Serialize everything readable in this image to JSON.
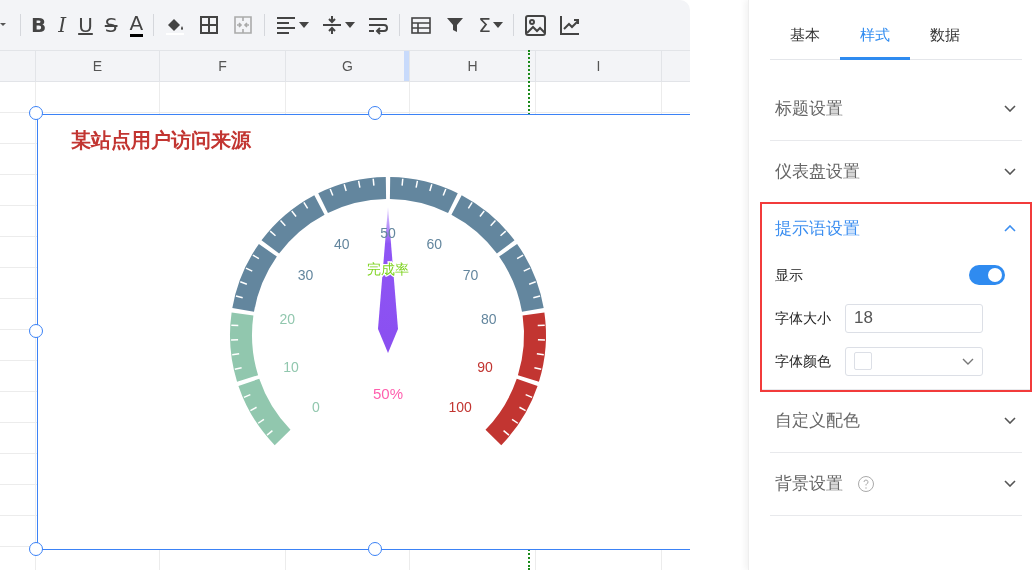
{
  "toolbar": [
    {
      "kind": "bold",
      "label": "B",
      "disabled": false,
      "dropdown": false
    },
    {
      "kind": "italic",
      "label": "I",
      "disabled": false,
      "dropdown": false
    },
    {
      "kind": "underline",
      "label": "U",
      "disabled": false,
      "dropdown": false
    },
    {
      "kind": "strike",
      "label": "S",
      "disabled": false,
      "dropdown": false
    },
    {
      "kind": "color",
      "label": "A",
      "disabled": false,
      "dropdown": false
    },
    {
      "kind": "fill",
      "disabled": false,
      "dropdown": false
    },
    {
      "kind": "borders",
      "disabled": false,
      "dropdown": false
    },
    {
      "kind": "merge",
      "disabled": true,
      "dropdown": false
    },
    {
      "kind": "align",
      "disabled": false,
      "dropdown": true
    },
    {
      "kind": "valign",
      "disabled": false,
      "dropdown": true
    },
    {
      "kind": "wrap",
      "disabled": false,
      "dropdown": false
    },
    {
      "kind": "table",
      "disabled": false,
      "dropdown": false
    },
    {
      "kind": "filter",
      "disabled": false,
      "dropdown": false
    },
    {
      "kind": "sum",
      "label": "Σ",
      "disabled": false,
      "dropdown": true
    },
    {
      "kind": "image",
      "disabled": false,
      "dropdown": false
    },
    {
      "kind": "chart",
      "disabled": false,
      "dropdown": false
    }
  ],
  "columns": [
    {
      "label": "E",
      "selected": false
    },
    {
      "label": "F",
      "selected": false
    },
    {
      "label": "G",
      "selected": true
    },
    {
      "label": "H",
      "selected": false
    },
    {
      "label": "I",
      "selected": false
    }
  ],
  "chart": {
    "title": "某站点用户访问来源",
    "gauge": {
      "name": "完成率",
      "detail": "50%",
      "level": 0.5,
      "segments": [
        {
          "color": "#91c7ae"
        },
        {
          "color": "#91c7ae"
        },
        {
          "color": "#63869e"
        },
        {
          "color": "#63869e"
        },
        {
          "color": "#63869e"
        },
        {
          "color": "#63869e"
        },
        {
          "color": "#63869e"
        },
        {
          "color": "#63869e"
        },
        {
          "color": "#c23531"
        },
        {
          "color": "#c23531"
        }
      ],
      "tick_labels": [
        "0",
        "10",
        "20",
        "30",
        "40",
        "50",
        "60",
        "70",
        "80",
        "90",
        "100"
      ]
    }
  },
  "panel": {
    "tabs": [
      {
        "label": "基本",
        "selected": false
      },
      {
        "label": "样式",
        "selected": true
      },
      {
        "label": "数据",
        "selected": false
      }
    ],
    "sections": [
      {
        "title": "标题设置",
        "expanded": false,
        "highlighted": false,
        "help": false
      },
      {
        "title": "仪表盘设置",
        "expanded": false,
        "highlighted": false,
        "help": false
      },
      {
        "title": "提示语设置",
        "expanded": true,
        "highlighted": true,
        "help": false,
        "fields": [
          {
            "kind": "toggle",
            "label": "显示",
            "on": true
          },
          {
            "kind": "input",
            "label": "字体大小",
            "value": "18"
          },
          {
            "kind": "color",
            "label": "字体颜色",
            "color": "#ffffff"
          }
        ]
      },
      {
        "title": "自定义配色",
        "expanded": false,
        "highlighted": false,
        "help": false
      },
      {
        "title": "背景设置",
        "expanded": false,
        "highlighted": false,
        "help": true
      }
    ]
  }
}
